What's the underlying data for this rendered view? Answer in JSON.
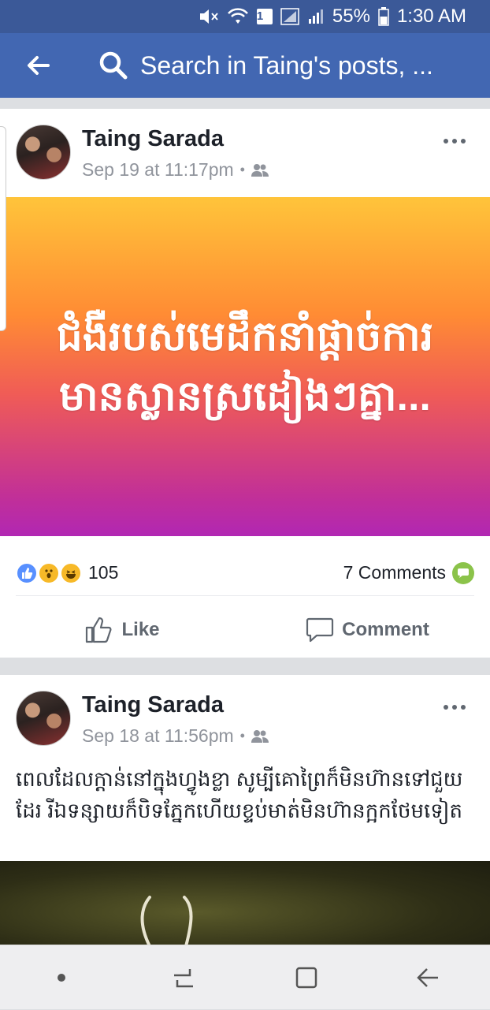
{
  "status_bar": {
    "sim": "1",
    "battery_percent": "55%",
    "time": "1:30 AM"
  },
  "top_bar": {
    "search_placeholder": "Search in Taing's posts, ..."
  },
  "posts": [
    {
      "author": "Taing Sarada",
      "timestamp": "Sep 19 at 11:17pm",
      "body": "ជំងឺរបស់មេដឹកនាំផ្តាច់ការមានស្លានស្រដៀងៗគ្នា...",
      "reaction_count": "105",
      "comments_label": "7 Comments",
      "colors": {
        "gradient_top": "#ffc43a",
        "gradient_bottom": "#b127b3"
      }
    },
    {
      "author": "Taing Sarada",
      "timestamp": "Sep 18 at 11:56pm",
      "body": "ពេលដែលក្តាន់នៅក្នុងហ្វូងខ្លា សូម្បីគោព្រៃក៏មិនហ៊ានទៅជួយដែរ រីឯទន្សាយក៏បិទភ្នែកហើយខ្ទប់មាត់មិនហ៊ានក្អកថែមទៀត"
    }
  ],
  "actions": {
    "like_label": "Like",
    "comment_label": "Comment"
  },
  "colors": {
    "brand": "#4267b2",
    "status_bar": "#3b5998"
  }
}
